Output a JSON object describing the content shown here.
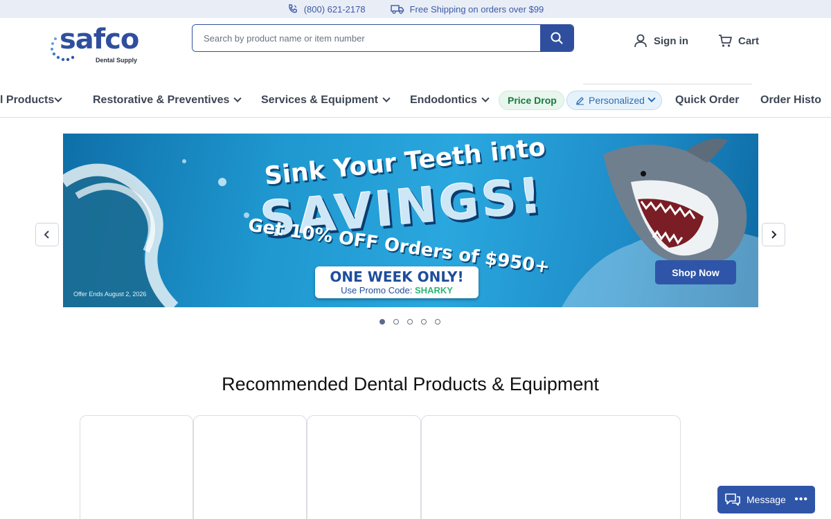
{
  "topbar": {
    "phone": "(800) 621-2178",
    "shipping": "Free Shipping on orders over $99"
  },
  "logo": {
    "word": "safco",
    "sub": "Dental Supply"
  },
  "search": {
    "placeholder": "Search by product name or item number"
  },
  "account": {
    "signin": "Sign in",
    "cart": "Cart"
  },
  "nav": {
    "items": [
      "l Products",
      "Restorative & Preventives",
      "Services & Equipment",
      "Endodontics",
      "Price Drop",
      "Personalized",
      "Quick Order",
      "Order Histo"
    ]
  },
  "banner": {
    "line1": "Sink Your Teeth into",
    "line2": "SAVINGS!",
    "line3": "Get 10% OFF Orders of $950+",
    "promo_title": "ONE WEEK ONLY!",
    "promo_prefix": "Use Promo Code:",
    "promo_code": "SHARKY",
    "fine_print": "Offer Ends August 2, 2026",
    "cta": "Shop Now",
    "colors": {
      "primary": "#2f55a8",
      "promo_code": "#2bb673"
    }
  },
  "carousel": {
    "active_index": 0,
    "count": 5
  },
  "section": {
    "title": "Recommended Dental Products & Equipment"
  },
  "chat": {
    "label": "Message",
    "menu": "•••"
  }
}
